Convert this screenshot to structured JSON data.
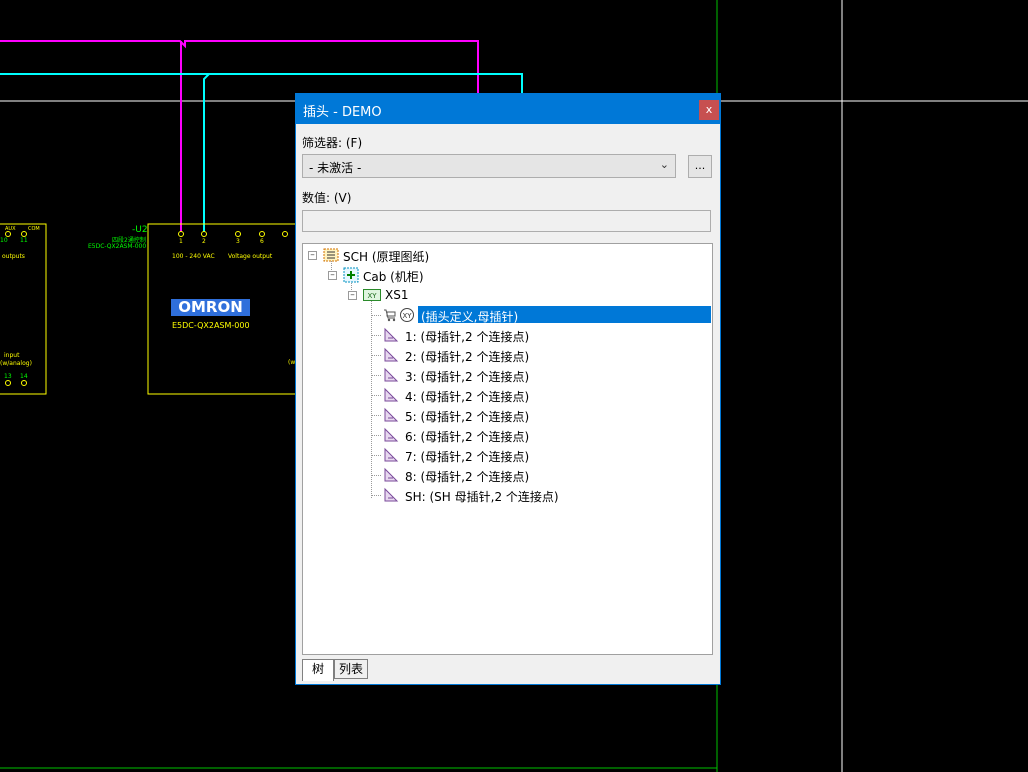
{
  "schematic": {
    "device_tag": "-U2",
    "device_desc": "四段2通控制",
    "device_part": "E5DC-QX2ASM-000",
    "brand_logo": "OMRON",
    "part_label": "E5DC-QX2ASM-000",
    "pins_top": [
      "1",
      "2",
      "3",
      "6"
    ],
    "pin_supply_label": "100 - 240 VAC",
    "pin_voltage_label": "Voltage output",
    "left_block_pins": [
      "10",
      "11"
    ],
    "left_block_heads": [
      "AUX",
      "COM"
    ],
    "left_block_outputs": "outputs",
    "left_block_input": "input",
    "left_block_analog": "(w/analog)",
    "left_block_bottom_pins": [
      "13",
      "14"
    ],
    "right_paren": "(w"
  },
  "dialog": {
    "title": "插头 - DEMO",
    "close_label": "x",
    "filter_label": "筛选器: (F)",
    "filter_value": "- 未激活 -",
    "more_label": "...",
    "value_label": "数值: (V)",
    "value_text": "",
    "tree": [
      {
        "icon": "schematic-list-icon",
        "label": "SCH (原理图纸)"
      },
      {
        "icon": "cabinet-icon",
        "label": "Cab (机柜)"
      },
      {
        "icon": "xy-plug-icon",
        "label": "XS1"
      },
      {
        "icon": "plug-definition-icon",
        "label": "(插头定义,母插针)",
        "selected": true
      },
      {
        "icon": "female-pin-icon",
        "label": "1: (母插针,2 个连接点)"
      },
      {
        "icon": "female-pin-icon",
        "label": "2: (母插针,2 个连接点)"
      },
      {
        "icon": "female-pin-icon",
        "label": "3: (母插针,2 个连接点)"
      },
      {
        "icon": "female-pin-icon",
        "label": "4: (母插针,2 个连接点)"
      },
      {
        "icon": "female-pin-icon",
        "label": "5: (母插针,2 个连接点)"
      },
      {
        "icon": "female-pin-icon",
        "label": "6: (母插针,2 个连接点)"
      },
      {
        "icon": "female-pin-icon",
        "label": "7: (母插针,2 个连接点)"
      },
      {
        "icon": "female-pin-icon",
        "label": "8: (母插针,2 个连接点)"
      },
      {
        "icon": "female-pin-icon",
        "label": "SH: (SH 母插针,2 个连接点)"
      }
    ],
    "tabs": [
      "树",
      "列表"
    ],
    "active_tab": "树"
  },
  "colors": {
    "background": "#000000",
    "wire_magenta": "#ff00ff",
    "wire_cyan": "#00ffff",
    "device_outline": "#ffff00",
    "device_text": "#ffff00",
    "green_text": "#00ff00",
    "border_green": "#00c000",
    "dialog_accent": "#0078d7",
    "close_red": "#c75050"
  }
}
